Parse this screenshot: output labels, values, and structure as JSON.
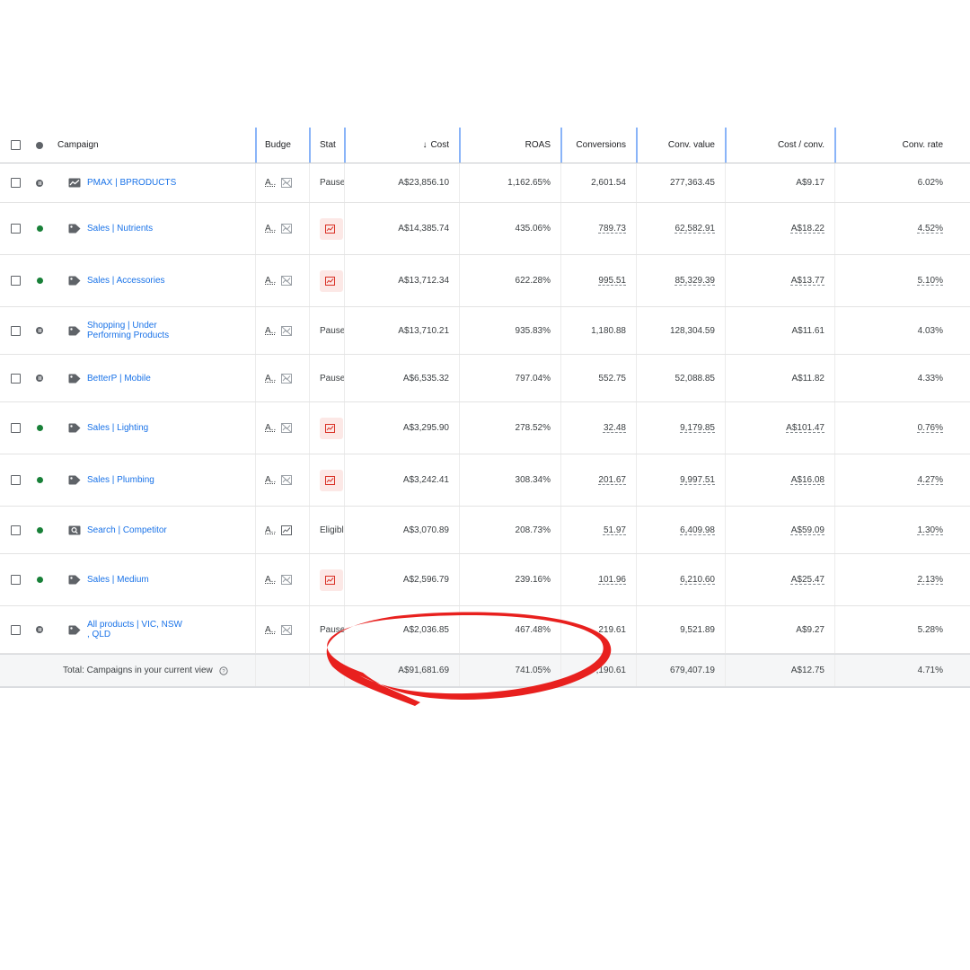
{
  "header": {
    "campaign": "Campaign",
    "budget": "Budge",
    "status": "Stat",
    "cost_arrow": "↓",
    "cost": "Cost",
    "roas": "ROAS",
    "conversions": "Conversions",
    "conv_value": "Conv. value",
    "cost_per_conv": "Cost / conv.",
    "conv_rate": "Conv. rate"
  },
  "budget_abbrev": "A..",
  "rows": [
    {
      "name1": "PMAX | BPRODUCTS",
      "name2": "",
      "state": "paused",
      "icon": "pmax-icon",
      "status": "Pause",
      "cost": "A$23,856.10",
      "roas": "1,162.65%",
      "conversions": "2,601.54",
      "conv_value": "277,363.45",
      "cost_per_conv": "A$9.17",
      "conv_rate": "6.02%"
    },
    {
      "name1": "Sales | Nutrients",
      "name2": "",
      "state": "enabled",
      "icon": "shopping-tag-icon",
      "status": "",
      "cost": "A$14,385.74",
      "roas": "435.06%",
      "conversions": "789.73",
      "conv_value": "62,582.91",
      "cost_per_conv": "A$18.22",
      "conv_rate": "4.52%"
    },
    {
      "name1": "Sales | Accessories",
      "name2": "",
      "state": "enabled",
      "icon": "shopping-tag-icon",
      "status": "",
      "cost": "A$13,712.34",
      "roas": "622.28%",
      "conversions": "995.51",
      "conv_value": "85,329.39",
      "cost_per_conv": "A$13.77",
      "conv_rate": "5.10%"
    },
    {
      "name1": "Shopping | Under",
      "name2": "Performing Products",
      "state": "paused",
      "icon": "shopping-tag-icon",
      "status": "Pause",
      "cost": "A$13,710.21",
      "roas": "935.83%",
      "conversions": "1,180.88",
      "conv_value": "128,304.59",
      "cost_per_conv": "A$11.61",
      "conv_rate": "4.03%"
    },
    {
      "name1": "BetterP | Mobile",
      "name2": "",
      "state": "paused",
      "icon": "shopping-tag-icon",
      "status": "Pause",
      "cost": "A$6,535.32",
      "roas": "797.04%",
      "conversions": "552.75",
      "conv_value": "52,088.85",
      "cost_per_conv": "A$11.82",
      "conv_rate": "4.33%"
    },
    {
      "name1": "Sales | Lighting",
      "name2": "",
      "state": "enabled",
      "icon": "shopping-tag-icon",
      "status": "",
      "cost": "A$3,295.90",
      "roas": "278.52%",
      "conversions": "32.48",
      "conv_value": "9,179.85",
      "cost_per_conv": "A$101.47",
      "conv_rate": "0.76%"
    },
    {
      "name1": "Sales | Plumbing",
      "name2": "",
      "state": "enabled",
      "icon": "shopping-tag-icon",
      "status": "",
      "cost": "A$3,242.41",
      "roas": "308.34%",
      "conversions": "201.67",
      "conv_value": "9,997.51",
      "cost_per_conv": "A$16.08",
      "conv_rate": "4.27%"
    },
    {
      "name1": "Search | Competitor",
      "name2": "",
      "state": "enabled",
      "icon": "search-campaign-icon",
      "status": "Eligibl",
      "cost": "A$3,070.89",
      "roas": "208.73%",
      "conversions": "51.97",
      "conv_value": "6,409.98",
      "cost_per_conv": "A$59.09",
      "conv_rate": "1.30%"
    },
    {
      "name1": "Sales | Medium",
      "name2": "",
      "state": "enabled",
      "icon": "shopping-tag-icon",
      "status": "",
      "cost": "A$2,596.79",
      "roas": "239.16%",
      "conversions": "101.96",
      "conv_value": "6,210.60",
      "cost_per_conv": "A$25.47",
      "conv_rate": "2.13%"
    },
    {
      "name1": "All products | VIC,  NSW",
      "name2": ", QLD",
      "state": "paused",
      "icon": "shopping-tag-icon",
      "status": "Pause",
      "cost": "A$2,036.85",
      "roas": "467.48%",
      "conversions": "219.61",
      "conv_value": "9,521.89",
      "cost_per_conv": "A$9.27",
      "conv_rate": "5.28%"
    }
  ],
  "total": {
    "label": "Total: Campaigns in your current view",
    "cost": "A$91,681.69",
    "roas": "741.05%",
    "conversions": "-,190.61",
    "conv_value": "679,407.19",
    "cost_per_conv": "A$12.75",
    "conv_rate": "4.71%"
  },
  "colors": {
    "link": "#1a73e8",
    "enabled": "#188038",
    "limited_badge": "#fce8e6",
    "limited_icon": "#d93025",
    "annotation": "#e8201e"
  }
}
